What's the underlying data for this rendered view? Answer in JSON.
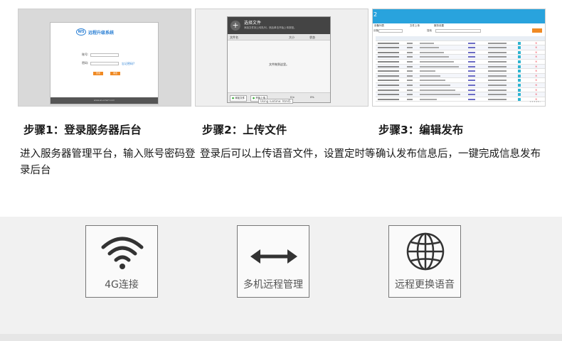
{
  "steps": [
    {
      "title": "步骤1：登录服务器后台",
      "description": "进入服务器管理平台，输入账号密码登录后台"
    },
    {
      "title": "步骤2：上传文件",
      "description": "登录后可以上传语音文件，设置定时等"
    },
    {
      "title": "步骤3：编辑发布",
      "description": "确认发布信息后，一键完成信息发布"
    }
  ],
  "login_mock": {
    "logo_text": "远程升级系统",
    "logo_badge": "WS",
    "user_label": "账号:",
    "pass_label": "密码:",
    "forgot_link": "忘记密码?",
    "login_button": "登录",
    "reset_button": "重置",
    "footer": "www.ws-smart.com"
  },
  "upload_mock": {
    "title": "选择文件",
    "subtitle": "添加文件到上传队列，然后单击开始上传按钮。",
    "columns": [
      "文件名",
      "大小",
      "状态"
    ],
    "empty_text": "文件拖到这里。",
    "add_button": "添加文件",
    "start_button": "开始上传",
    "size_total": "0 b",
    "percent": "0%",
    "runtime": "Using runtime: html5"
  },
  "publish_mock": {
    "logo_char": "2",
    "tabs": [
      "设备列表",
      "文件上传",
      "服务设置"
    ],
    "select_label": "设备",
    "search_label": "搜索",
    "row_count": 13,
    "footer": "1 2 3 4 5 ›"
  },
  "features": [
    {
      "icon": "wifi-icon",
      "label": "4G连接"
    },
    {
      "icon": "double-arrow-icon",
      "label": "多机远程管理"
    },
    {
      "icon": "globe-icon",
      "label": "远程更换语音"
    }
  ]
}
